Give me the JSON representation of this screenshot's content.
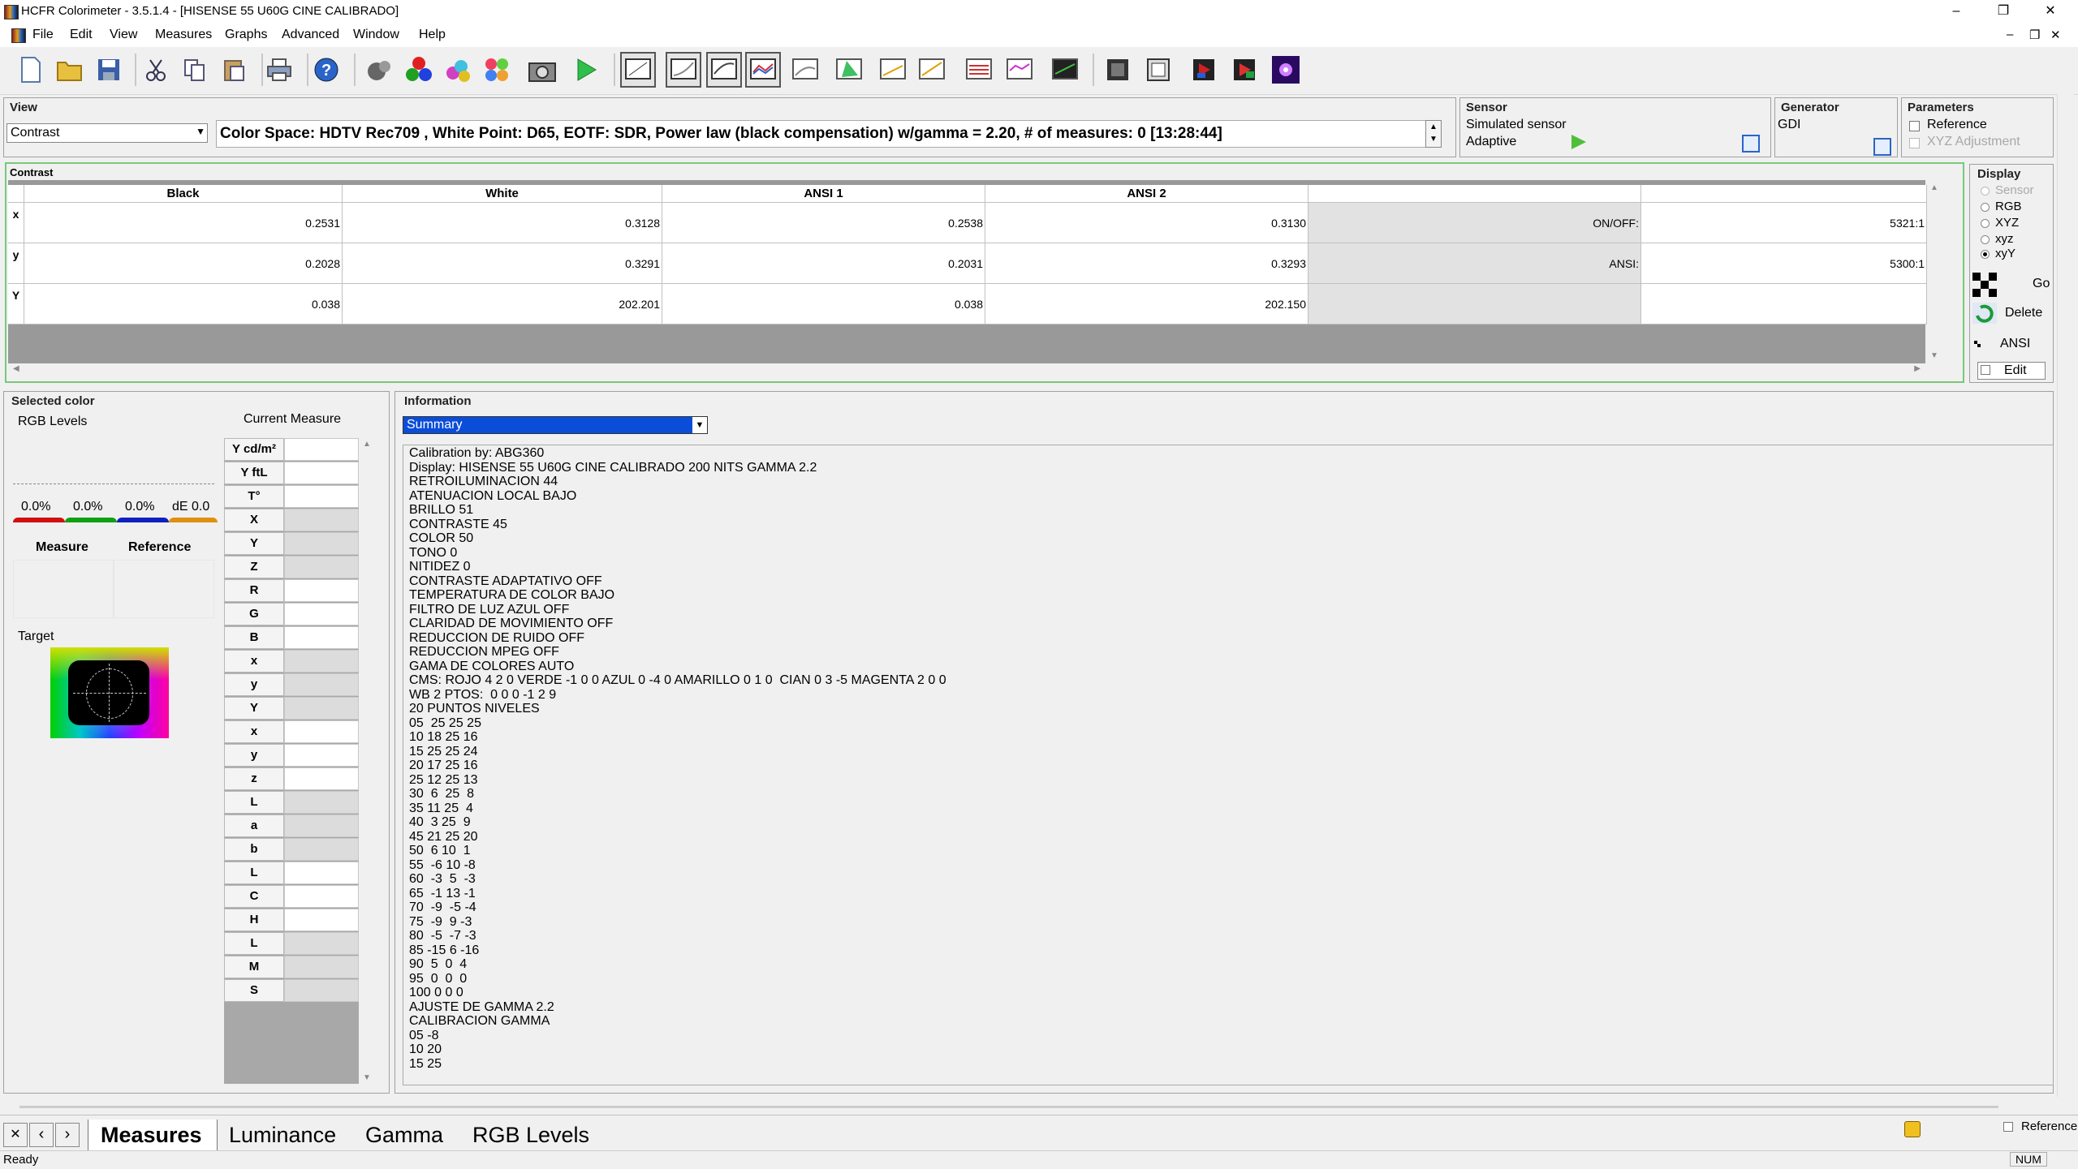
{
  "window": {
    "title": "HCFR Colorimeter - 3.5.1.4 - [HISENSE 55 U60G CINE CALIBRADO]",
    "controls": {
      "minimize": "–",
      "restore": "❐",
      "close": "✕"
    },
    "mdi_controls": {
      "minimize": "–",
      "restore": "❐",
      "close": "✕"
    }
  },
  "menu": [
    "File",
    "Edit",
    "View",
    "Measures",
    "Graphs",
    "Advanced",
    "Window",
    "Help"
  ],
  "view_panel": {
    "title": "View",
    "select_value": "Contrast",
    "info_line": "Color Space: HDTV Rec709 , White Point: D65, EOTF:  SDR, Power law (black compensation) w/gamma = 2.20, # of measures: 0 [13:28:44]"
  },
  "sensor_panel": {
    "title": "Sensor",
    "name": "Simulated sensor",
    "mode": "Adaptive"
  },
  "generator_panel": {
    "title": "Generator",
    "name": "GDI"
  },
  "parameters_panel": {
    "title": "Parameters",
    "reference": "Reference",
    "xyz_adjustment": "XYZ Adjustment"
  },
  "contrast_table": {
    "title": "Contrast",
    "columns": [
      "Black",
      "White",
      "ANSI 1",
      "ANSI 2"
    ],
    "rows": [
      {
        "head": "x",
        "values": [
          "0.2531",
          "0.3128",
          "0.2538",
          "0.3130"
        ],
        "label": "ON/OFF:",
        "result": "5321:1"
      },
      {
        "head": "y",
        "values": [
          "0.2028",
          "0.3291",
          "0.2031",
          "0.3293"
        ],
        "label": "ANSI:",
        "result": "5300:1"
      },
      {
        "head": "Y",
        "values": [
          "0.038",
          "202.201",
          "0.038",
          "202.150"
        ],
        "label": "",
        "result": ""
      }
    ]
  },
  "display_panel": {
    "title": "Display",
    "options": [
      "Sensor",
      "RGB",
      "XYZ",
      "xyz",
      "xyY"
    ],
    "selected": "xyY",
    "buttons": {
      "go": "Go",
      "delete": "Delete",
      "ansi": "ANSI",
      "edit": "Edit"
    }
  },
  "selected_color": {
    "title": "Selected color",
    "rgb_levels": "RGB Levels",
    "current_measure": "Current Measure",
    "percents": [
      "0.0%",
      "0.0%",
      "0.0%"
    ],
    "de": "dE 0.0",
    "measure": "Measure",
    "reference": "Reference",
    "target": "Target",
    "measure_labels": [
      "Y cd/m²",
      "Y ftL",
      "T°",
      "X",
      "Y",
      "Z",
      "R",
      "G",
      "B",
      "x",
      "y",
      "Y",
      "x",
      "y",
      "z",
      "L",
      "a",
      "b",
      "L",
      "C",
      "H",
      "L",
      "M",
      "S"
    ]
  },
  "information": {
    "title": "Information",
    "select_value": "Summary",
    "lines": [
      "Calibration by: ABG360",
      "Display: HISENSE 55 U60G CINE CALIBRADO 200 NITS GAMMA 2.2",
      "RETROILUMINACION 44",
      "ATENUACION LOCAL BAJO",
      "BRILLO 51",
      "CONTRASTE 45",
      "COLOR 50",
      "TONO 0",
      "NITIDEZ 0",
      "CONTRASTE ADAPTATIVO OFF",
      "TEMPERATURA DE COLOR BAJO",
      "FILTRO DE LUZ AZUL OFF",
      "CLARIDAD DE MOVIMIENTO OFF",
      "REDUCCION DE RUIDO OFF",
      "REDUCCION MPEG OFF",
      "GAMA DE COLORES AUTO",
      "CMS: ROJO 4 2 0 VERDE -1 0 0 AZUL 0 -4 0 AMARILLO 0 1 0  CIAN 0 3 -5 MAGENTA 2 0 0",
      "WB 2 PTOS:  0 0 0 -1 2 9",
      "20 PUNTOS NIVELES",
      "05  25 25 25",
      "10 18 25 16",
      "15 25 25 24",
      "20 17 25 16",
      "25 12 25 13",
      "30  6  25  8",
      "35 11 25  4",
      "40  3 25  9",
      "45 21 25 20",
      "50  6 10  1",
      "55  -6 10 -8",
      "60  -3  5  -3",
      "65  -1 13 -1",
      "70  -9  -5 -4",
      "75  -9  9 -3",
      "80  -5  -7 -3",
      "85 -15 6 -16",
      "90  5  0  4",
      "95  0  0  0",
      "100 0 0 0",
      "AJUSTE DE GAMMA 2.2",
      "CALIBRACION GAMMA",
      "05 -8",
      "10 20",
      "15 25"
    ]
  },
  "tabs": [
    "Measures",
    "Luminance",
    "Gamma",
    "RGB Levels"
  ],
  "active_tab": "Measures",
  "tab_nav": [
    "✕",
    "‹",
    "›"
  ],
  "bottom_reference": "Reference",
  "status": {
    "text": "Ready",
    "num": "NUM"
  },
  "colors": {
    "green_border": "#7ac77a",
    "selection_blue": "#0a4dd8"
  }
}
